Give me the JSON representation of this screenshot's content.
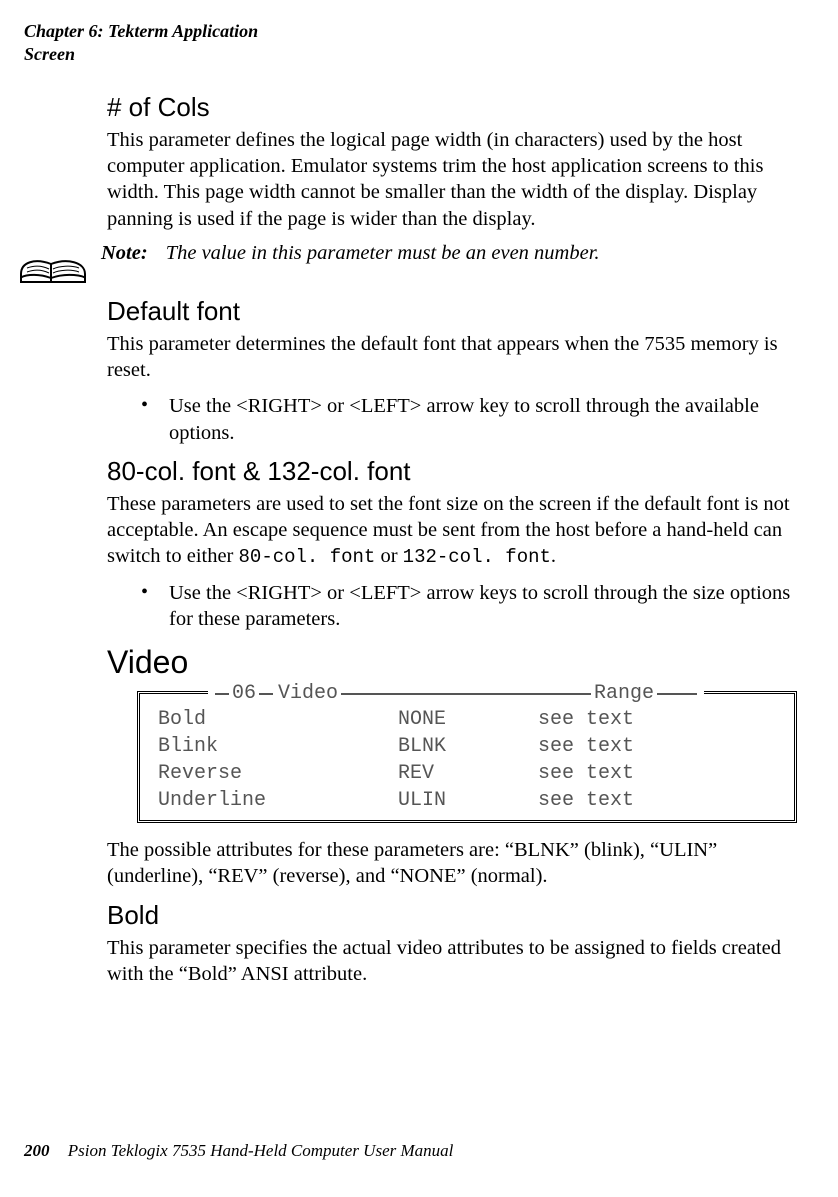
{
  "running_head": {
    "line1": "Chapter 6: Tekterm Application",
    "line2": "Screen"
  },
  "sections": {
    "cols": {
      "title": "# of Cols",
      "para": "This parameter defines the logical page width (in characters) used by the host computer application. Emulator systems trim the host application screens to this width. This page width cannot be smaller than the width of the display. Display panning is used if the page is wider than the display."
    },
    "note": {
      "label": "Note:",
      "body": "The value in this parameter must be an even number."
    },
    "default_font": {
      "title": "Default font",
      "para": "This parameter determines the default font that appears when the 7535 memory is reset.",
      "bullet": "Use the <RIGHT> or <LEFT> arrow key to scroll through the available options."
    },
    "col_fonts": {
      "title": "80-col. font & 132-col. font",
      "para_pre": "These parameters are used to set the font size on the screen if the default font is not acceptable. An escape sequence must be sent from the host before a hand-held can switch to either ",
      "mono1": "80-col. font",
      "or": " or ",
      "mono2": "132-col. font",
      "period": ".",
      "bullet": "Use the <RIGHT> or <LEFT> arrow keys to scroll through the size options for these parameters."
    },
    "video": {
      "title": "Video",
      "legend_num": "06",
      "legend_title": "Video",
      "legend_range": "Range",
      "rows": [
        {
          "name": "Bold",
          "val": "NONE",
          "range": "see text"
        },
        {
          "name": "Blink",
          "val": "BLNK",
          "range": "see text"
        },
        {
          "name": "Reverse",
          "val": "REV",
          "range": "see text"
        },
        {
          "name": "Underline",
          "val": "ULIN",
          "range": "see text"
        }
      ],
      "after": "The possible attributes for these parameters are: “BLNK” (blink), “ULIN” (underline), “REV” (reverse), and “NONE” (normal)."
    },
    "bold": {
      "title": "Bold",
      "para": "This parameter specifies the actual video attributes to be assigned to fields created with the “Bold” ANSI attribute."
    }
  },
  "footer": {
    "page": "200",
    "text": "Psion Teklogix 7535 Hand-Held Computer User Manual"
  }
}
